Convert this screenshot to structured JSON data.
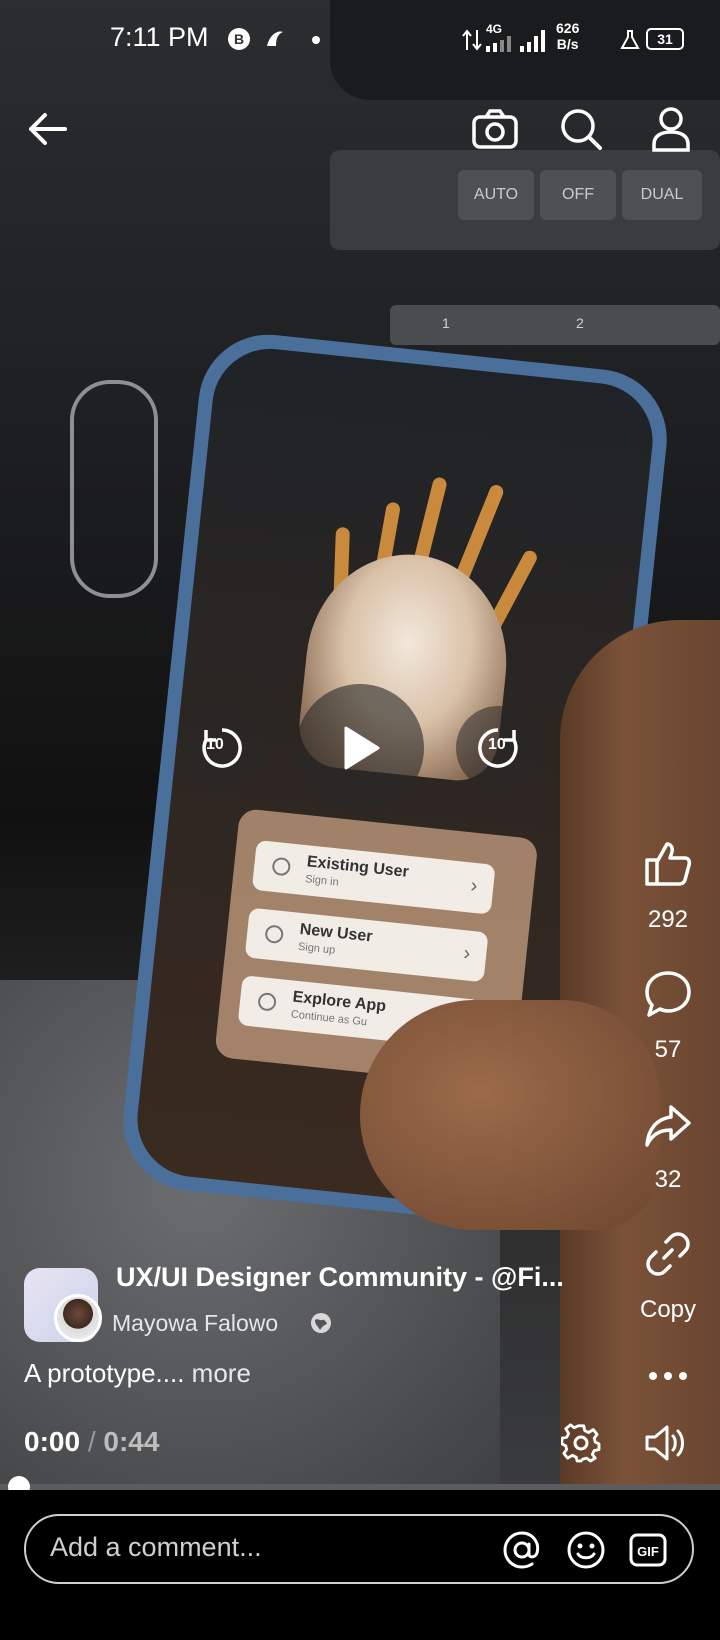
{
  "status_bar": {
    "time": "7:11 PM",
    "network_type": "4G",
    "speed_value": "626",
    "speed_unit": "B/s",
    "battery": "31"
  },
  "header": {
    "back_icon": "arrow-left-icon",
    "camera_icon": "camera-icon",
    "search_icon": "search-icon",
    "profile_icon": "person-icon"
  },
  "video_scene": {
    "dash_buttons": [
      "AUTO",
      "OFF",
      "DUAL"
    ],
    "dash_strip": [
      "1",
      "2"
    ],
    "phone_menu": [
      {
        "title": "Existing User",
        "subtitle": "Sign in"
      },
      {
        "title": "New User",
        "subtitle": "Sign up"
      },
      {
        "title": "Explore App",
        "subtitle": "Continue as Gu"
      }
    ]
  },
  "player_controls": {
    "rewind_seconds": "10",
    "forward_seconds": "10",
    "play_icon": "play-icon"
  },
  "actions": {
    "like_count": "292",
    "comment_count": "57",
    "share_count": "32",
    "copy_label": "Copy"
  },
  "post": {
    "group_name": "UX/UI Designer Community - @Fi...",
    "author": "Mayowa Falowo",
    "caption": "A prototype....",
    "more_label": "more",
    "current_time": "0:00",
    "separator": "/",
    "duration": "0:44",
    "progress_fraction": 0.0
  },
  "comment": {
    "placeholder": "Add a comment..."
  },
  "colors": {
    "phone_case": "#4a6f9a",
    "background": "#000000"
  }
}
